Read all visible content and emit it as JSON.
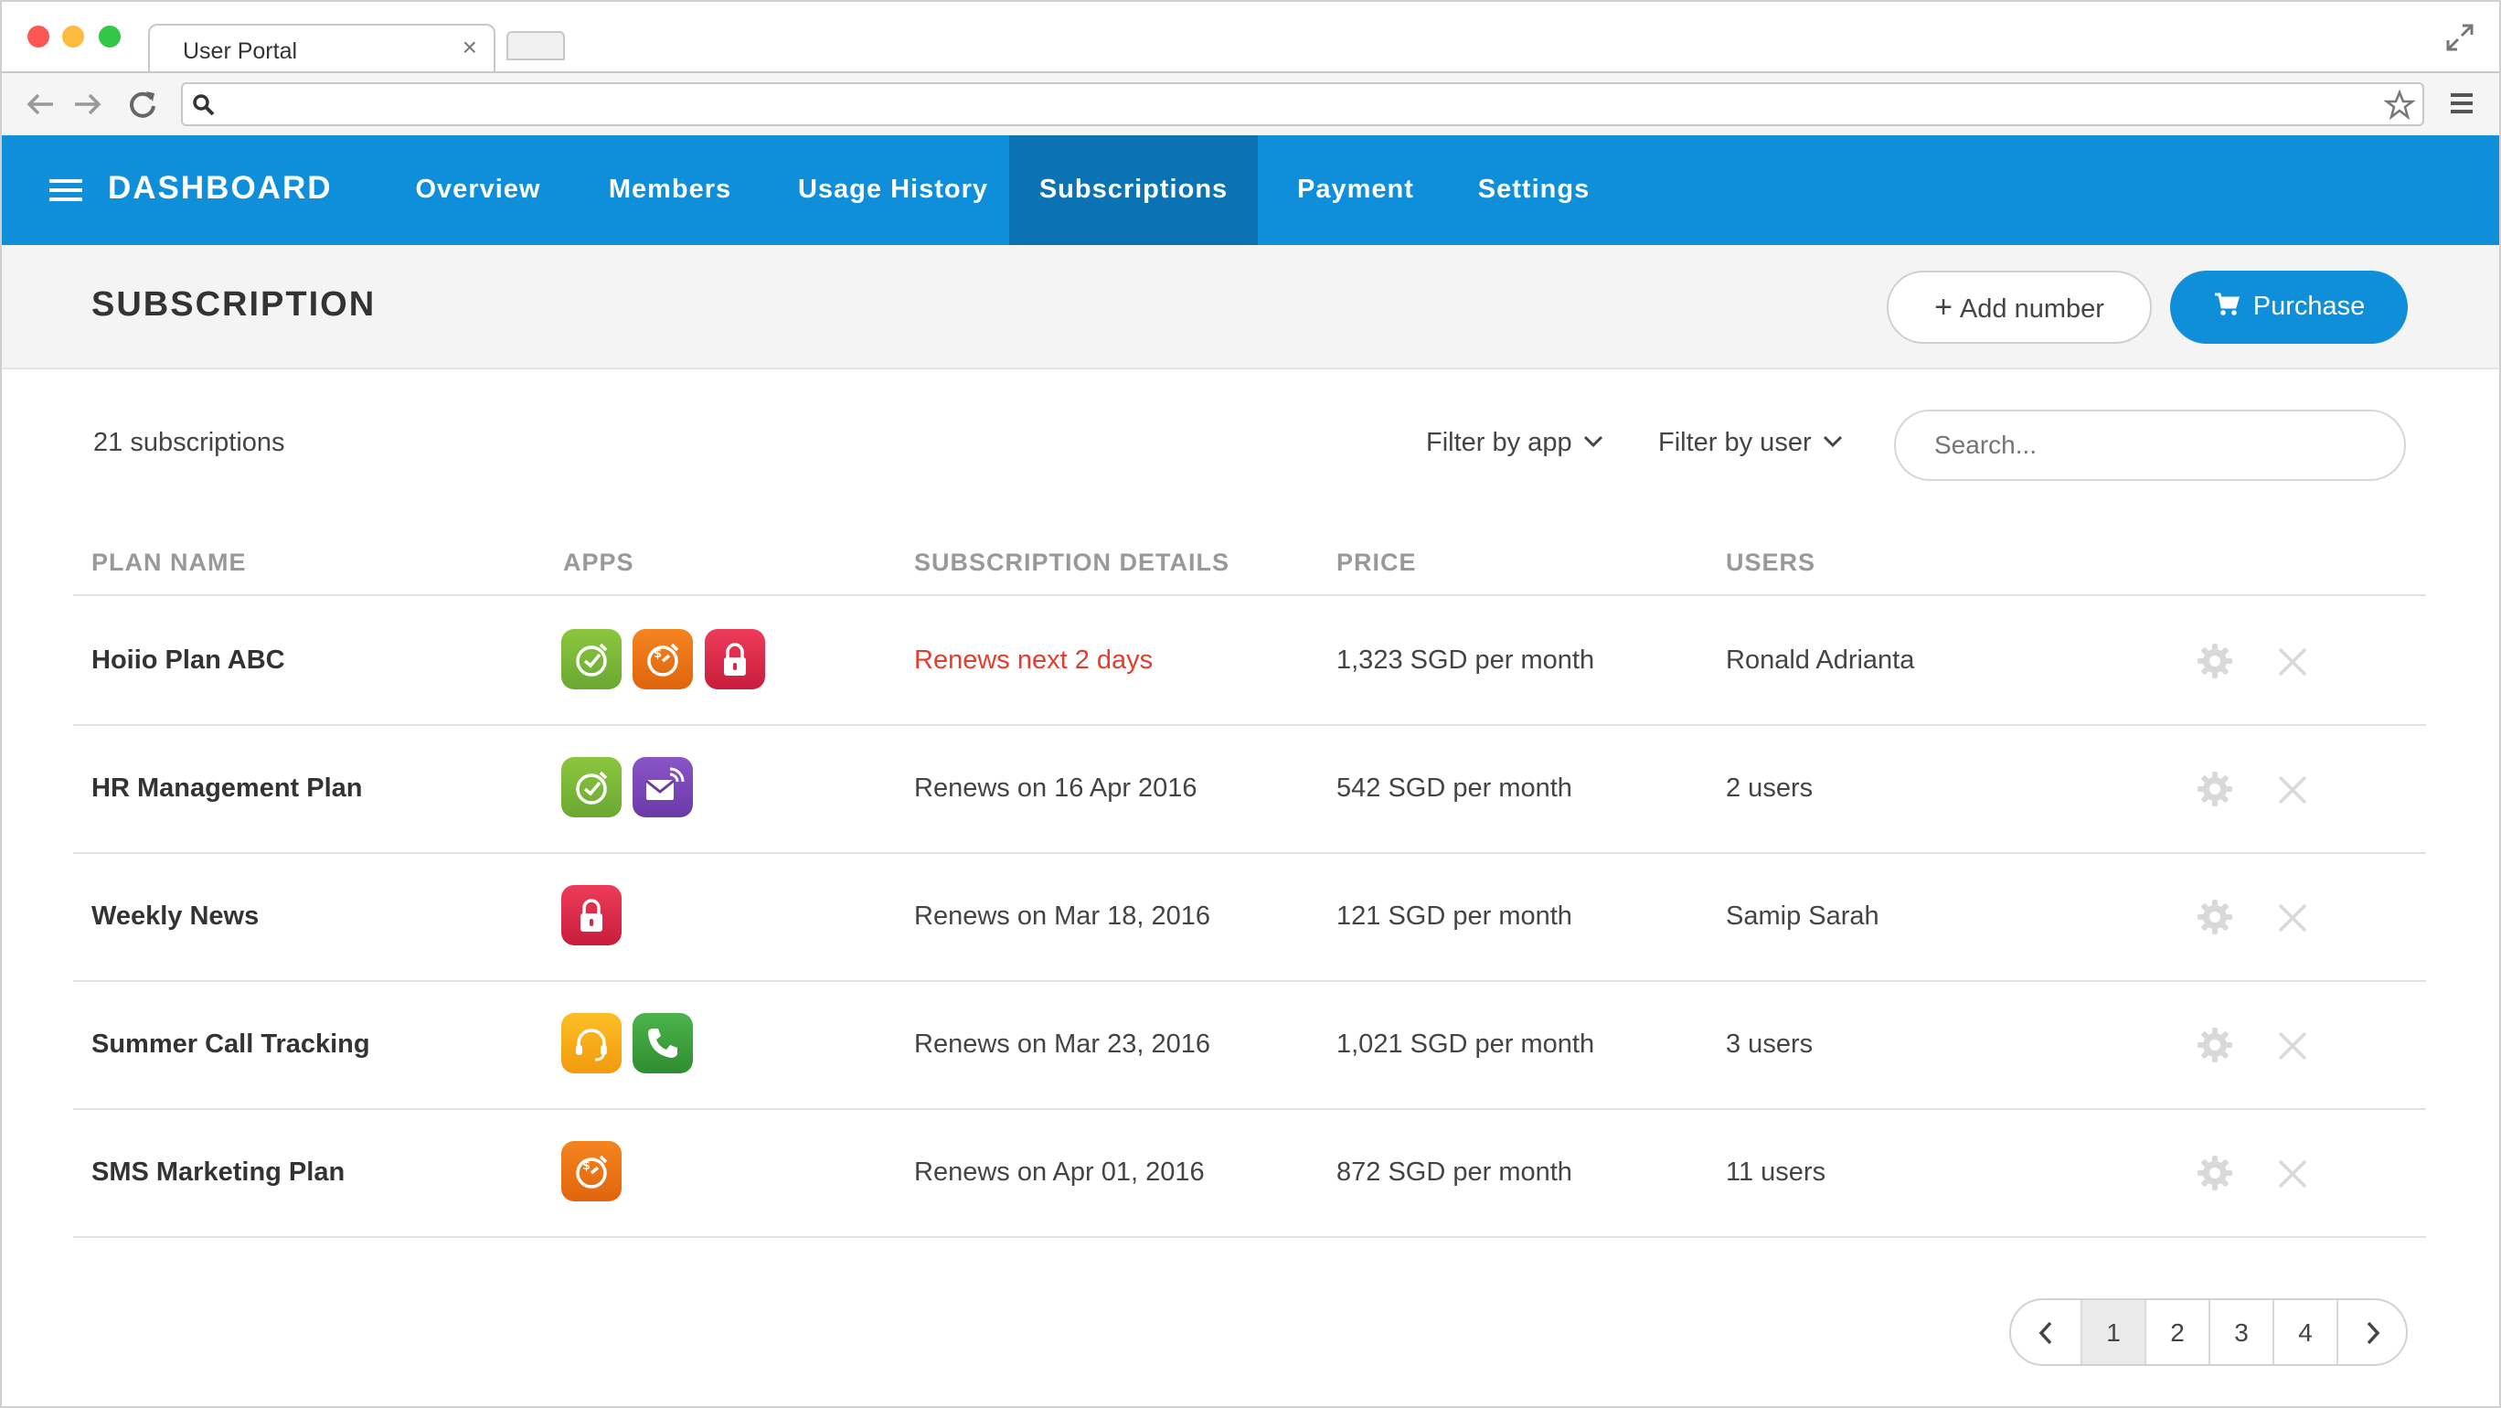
{
  "browser": {
    "tab_title": "User Portal",
    "url": ""
  },
  "nav": {
    "brand": "DASHBOARD",
    "items": [
      {
        "label": "Overview"
      },
      {
        "label": "Members"
      },
      {
        "label": "Usage History"
      },
      {
        "label": "Subscriptions",
        "active": true
      },
      {
        "label": "Payment"
      },
      {
        "label": "Settings"
      }
    ],
    "color": "#0f8ed9",
    "active_color": "#0b73b4"
  },
  "header": {
    "title": "SUBSCRIPTION",
    "add_number_label": "Add number",
    "purchase_label": "Purchase"
  },
  "filters": {
    "count_text": "21 subscriptions",
    "filter_app_label": "Filter by app",
    "filter_user_label": "Filter by user",
    "search_placeholder": "Search..."
  },
  "table": {
    "columns": [
      "PLAN NAME",
      "APPS",
      "SUBSCRIPTION DETAILS",
      "PRICE",
      "USERS"
    ],
    "rows": [
      {
        "plan": "Hoiio Plan ABC",
        "apps": [
          "clock-app-icon",
          "dollar-timer-app-icon",
          "lock-app-icon"
        ],
        "details": "Renews next 2 days",
        "details_warning": true,
        "price": "1,323 SGD per month",
        "users": "Ronald Adrianta"
      },
      {
        "plan": "HR Management Plan",
        "apps": [
          "clock-app-icon",
          "mail-app-icon"
        ],
        "details": "Renews on 16 Apr 2016",
        "details_warning": false,
        "price": "542 SGD per month",
        "users": "2 users"
      },
      {
        "plan": "Weekly News",
        "apps": [
          "lock-app-icon"
        ],
        "details": "Renews on Mar 18, 2016",
        "details_warning": false,
        "price": "121 SGD per month",
        "users": "Samip Sarah"
      },
      {
        "plan": "Summer Call Tracking",
        "apps": [
          "headset-app-icon",
          "phone-app-icon"
        ],
        "details": "Renews on Mar 23, 2016",
        "details_warning": false,
        "price": "1,021 SGD per month",
        "users": "3 users"
      },
      {
        "plan": "SMS Marketing Plan",
        "apps": [
          "dollar-timer-app-icon"
        ],
        "details": "Renews on Apr 01, 2016",
        "details_warning": false,
        "price": "872 SGD per month",
        "users": "11 users"
      }
    ],
    "warning_color": "#e63c2e"
  },
  "pagination": {
    "pages": [
      "1",
      "2",
      "3",
      "4"
    ],
    "current": "1"
  }
}
